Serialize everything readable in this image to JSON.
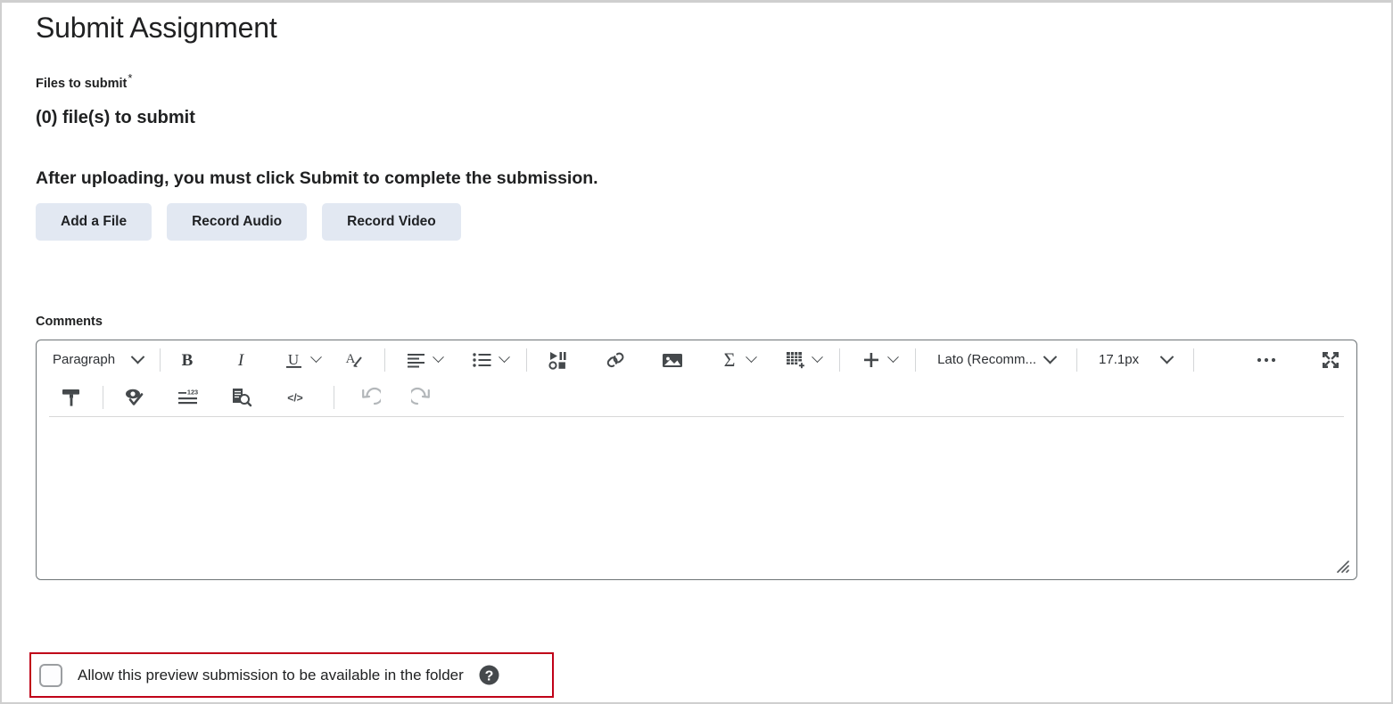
{
  "page": {
    "title": "Submit Assignment"
  },
  "files": {
    "label": "Files to submit",
    "required_marker": "*",
    "count_text": "(0) file(s) to submit",
    "notice": "After uploading, you must click Submit to complete the submission.",
    "buttons": [
      {
        "label": "Add a File",
        "name": "add-a-file-button"
      },
      {
        "label": "Record Audio",
        "name": "record-audio-button"
      },
      {
        "label": "Record Video",
        "name": "record-video-button"
      }
    ]
  },
  "comments": {
    "label": "Comments",
    "editor": {
      "toolbar_row1": {
        "paragraph_style": "Paragraph",
        "bold": "B",
        "italic": "I",
        "underline": "U",
        "font_family": "Lato (Recomm...",
        "font_size": "17.1px",
        "more_label": "•••"
      },
      "content": ""
    }
  },
  "consent": {
    "checkbox_label": "Allow this preview submission to be available in the folder",
    "checked": false,
    "help_tooltip": "?"
  },
  "colors": {
    "button_bg": "#e2e8f2",
    "highlight_border": "#c00018",
    "editor_border": "#6e7477",
    "icon": "#45494c",
    "icon_disabled": "#b3b7ba",
    "text": "#202122",
    "page_border": "#cfcfcf"
  }
}
